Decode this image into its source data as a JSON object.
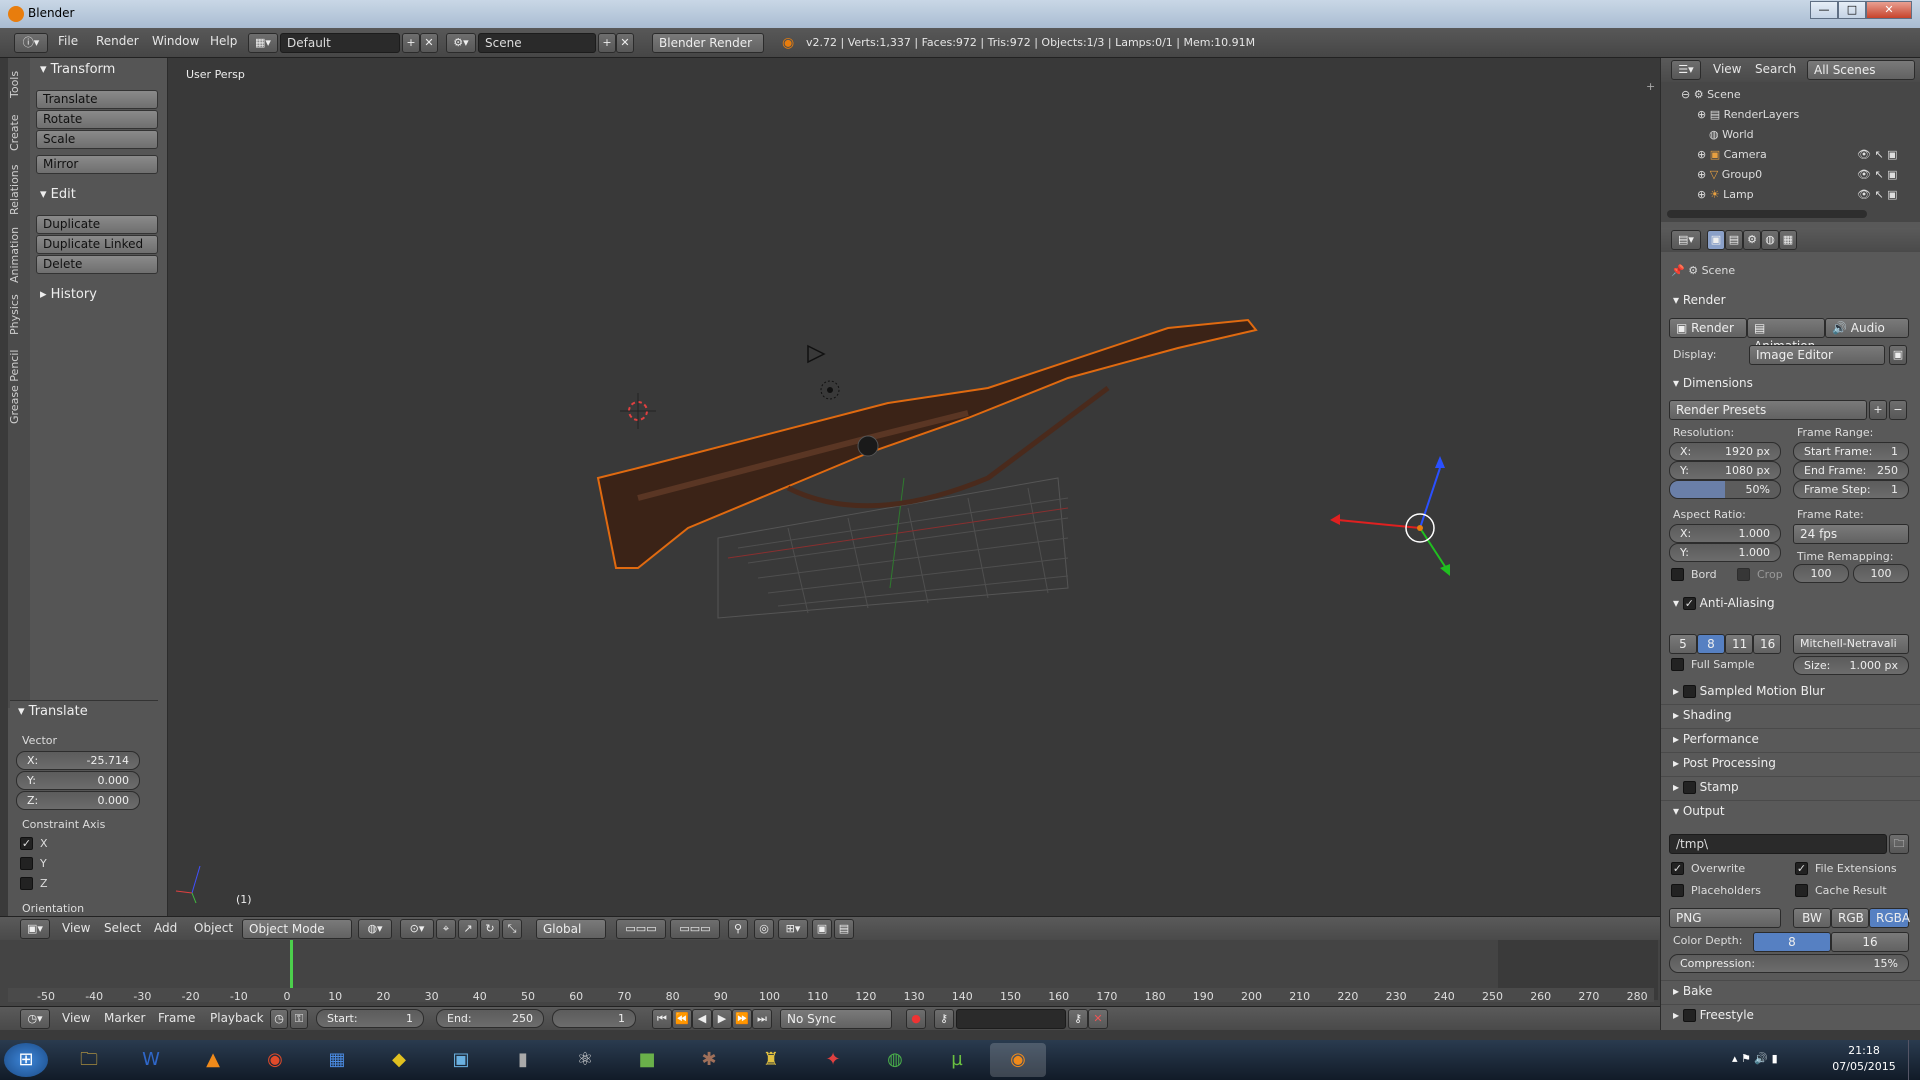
{
  "window": {
    "title": "Blender",
    "min": "—",
    "max": "□",
    "close": "✕"
  },
  "menu": {
    "file": "File",
    "render": "Render",
    "window": "Window",
    "help": "Help"
  },
  "layout": {
    "name": "Default",
    "scene": "Scene",
    "engine": "Blender Render"
  },
  "stats": "v2.72 | Verts:1,337 | Faces:972 | Tris:972 | Objects:1/3 | Lamps:0/1 | Mem:10.91M",
  "tabs": [
    "Tools",
    "Create",
    "Relations",
    "Animation",
    "Physics",
    "Grease Pencil"
  ],
  "transform": {
    "header": "Transform",
    "translate": "Translate",
    "rotate": "Rotate",
    "scale": "Scale",
    "mirror": "Mirror"
  },
  "edit": {
    "header": "Edit",
    "duplicate": "Duplicate",
    "duplicate_linked": "Duplicate Linked",
    "delete": "Delete"
  },
  "history": {
    "header": "History"
  },
  "operator": {
    "header": "Translate",
    "vector": "Vector",
    "x_label": "X:",
    "x": "-25.714",
    "y_label": "Y:",
    "y": "0.000",
    "z_label": "Z:",
    "z": "0.000",
    "constraint": "Constraint Axis",
    "cx": "X",
    "cy": "Y",
    "cz": "Z",
    "orientation": "Orientation"
  },
  "viewport": {
    "label": "User Persp",
    "frame": "(1)"
  },
  "vpheader": {
    "view": "View",
    "select": "Select",
    "add": "Add",
    "object": "Object",
    "mode": "Object Mode",
    "orientation": "Global"
  },
  "timeline": {
    "ticks": [
      "-50",
      "-40",
      "-30",
      "-20",
      "-10",
      "0",
      "10",
      "20",
      "30",
      "40",
      "50",
      "60",
      "70",
      "80",
      "90",
      "100",
      "110",
      "120",
      "130",
      "140",
      "150",
      "160",
      "170",
      "180",
      "190",
      "200",
      "210",
      "220",
      "230",
      "240",
      "250",
      "260",
      "270",
      "280"
    ],
    "view": "View",
    "marker": "Marker",
    "frame": "Frame",
    "playback": "Playback",
    "start_label": "Start:",
    "start": "1",
    "end_label": "End:",
    "end": "250",
    "current": "1",
    "sync": "No Sync"
  },
  "outliner": {
    "view": "View",
    "search": "Search",
    "scenes": "All Scenes",
    "items": [
      "Scene",
      "RenderLayers",
      "World",
      "Camera",
      "Group0",
      "Lamp"
    ]
  },
  "props": {
    "scene": "Scene",
    "render": {
      "header": "Render",
      "render_btn": "Render",
      "animation_btn": "Animation",
      "audio_btn": "Audio",
      "display_label": "Display:",
      "display": "Image Editor"
    },
    "dimensions": {
      "header": "Dimensions",
      "presets": "Render Presets",
      "resolution": "Resolution:",
      "rx_label": "X:",
      "rx": "1920 px",
      "ry_label": "Y:",
      "ry": "1080 px",
      "pct": "50%",
      "frame_range": "Frame Range:",
      "start_label": "Start Frame:",
      "start": "1",
      "end_label": "End Frame:",
      "end": "250",
      "step_label": "Frame Step:",
      "step": "1",
      "aspect": "Aspect Ratio:",
      "ax_label": "X:",
      "ax": "1.000",
      "ay_label": "Y:",
      "ay": "1.000",
      "frame_rate": "Frame Rate:",
      "fps": "24 fps",
      "remap": "Time Remapping:",
      "old": "100",
      "new": "100",
      "bord": "Bord",
      "crop": "Crop"
    },
    "aa": {
      "header": "Anti-Aliasing",
      "s5": "5",
      "s8": "8",
      "s11": "11",
      "s16": "16",
      "filter": "Mitchell-Netravali",
      "full": "Full Sample",
      "size_label": "Size:",
      "size": "1.000 px"
    },
    "sections": {
      "motion_blur": "Sampled Motion Blur",
      "shading": "Shading",
      "performance": "Performance",
      "post": "Post Processing",
      "stamp": "Stamp"
    },
    "output": {
      "header": "Output",
      "path": "/tmp\\",
      "overwrite": "Overwrite",
      "file_ext": "File Extensions",
      "placeholders": "Placeholders",
      "cache": "Cache Result",
      "format": "PNG",
      "bw": "BW",
      "rgb": "RGB",
      "rgba": "RGBA",
      "depth_label": "Color Depth:",
      "d8": "8",
      "d16": "16",
      "compression": "Compression:",
      "comp_val": "15%"
    },
    "bake": "Bake",
    "freestyle": "Freestyle"
  },
  "taskbar": {
    "time": "21:18",
    "date": "07/05/2015"
  }
}
